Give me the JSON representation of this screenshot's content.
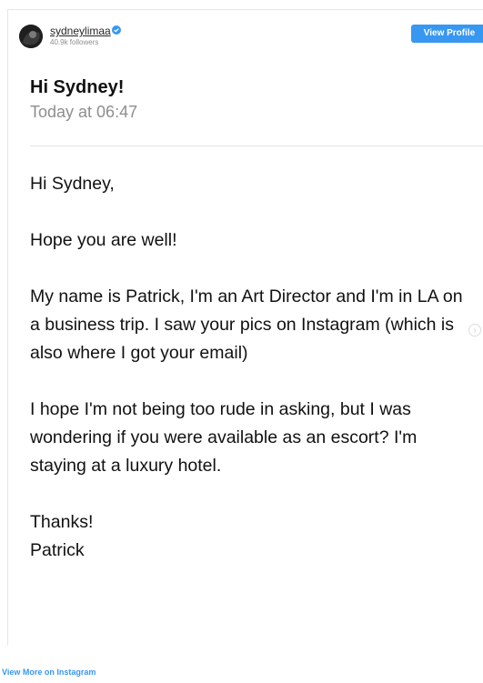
{
  "profile": {
    "username": "sydneylimaa",
    "followers": "40.9k followers",
    "view_profile_label": "View Profile"
  },
  "message": {
    "subject": "Hi Sydney!",
    "timestamp": "Today at 06:47",
    "paragraphs": [
      "Hi Sydney,",
      "Hope you are well!",
      "My name is Patrick, I'm an Art Director and I'm in LA on a business trip. I saw your pics on Instagram (which is also where I got your email)",
      "I hope I'm not being too rude in asking, but I was wondering if you were available as an escort? I'm staying at a luxury hotel.",
      "Thanks!",
      "Patrick"
    ]
  },
  "footer": {
    "more_link": "View More on Instagram"
  },
  "icons": {
    "verified": "verified-badge-icon",
    "scroll": "chevron-right-icon"
  },
  "colors": {
    "accent": "#3897f0",
    "muted": "#8e8e8e"
  }
}
